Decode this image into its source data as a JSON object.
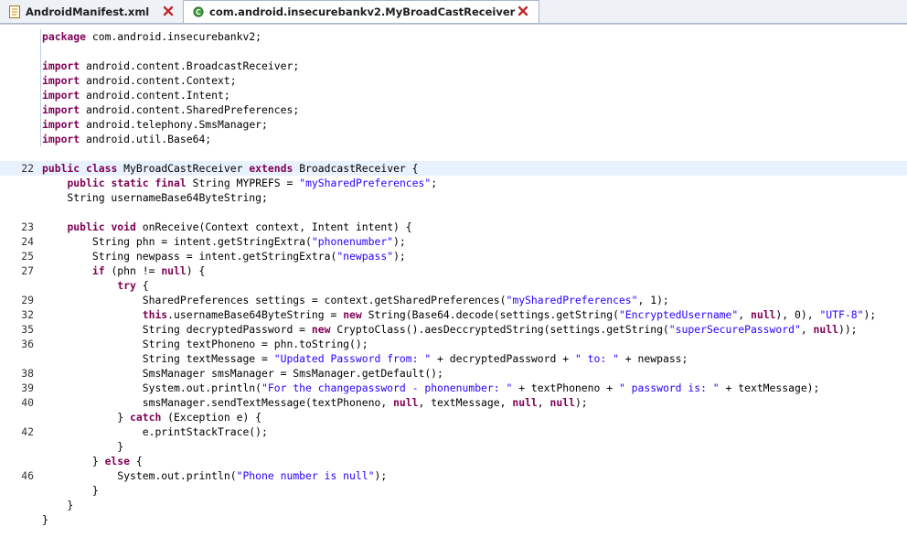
{
  "tabs": [
    {
      "label": "AndroidManifest.xml",
      "icon": "xml-file-icon",
      "active": false
    },
    {
      "label": "com.android.insecurebankv2.MyBroadCastReceiver",
      "icon": "java-class-icon",
      "active": true
    }
  ],
  "colors": {
    "keyword": "#7f0055",
    "string": "#2a00ff",
    "current_line": "#e8f2fe",
    "close": "#c1282d"
  },
  "code": [
    {
      "n": "",
      "parts": [
        {
          "t": "package",
          "c": "kw"
        },
        {
          "t": " com.android.insecurebankv2;"
        }
      ]
    },
    {
      "n": "",
      "parts": []
    },
    {
      "n": "",
      "parts": [
        {
          "t": "import",
          "c": "kw"
        },
        {
          "t": " android.content.BroadcastReceiver;"
        }
      ]
    },
    {
      "n": "",
      "parts": [
        {
          "t": "import",
          "c": "kw"
        },
        {
          "t": " android.content.Context;"
        }
      ]
    },
    {
      "n": "",
      "parts": [
        {
          "t": "import",
          "c": "kw"
        },
        {
          "t": " android.content.Intent;"
        }
      ]
    },
    {
      "n": "",
      "parts": [
        {
          "t": "import",
          "c": "kw"
        },
        {
          "t": " android.content.SharedPreferences;"
        }
      ]
    },
    {
      "n": "",
      "parts": [
        {
          "t": "import",
          "c": "kw"
        },
        {
          "t": " android.telephony.SmsManager;"
        }
      ]
    },
    {
      "n": "",
      "parts": [
        {
          "t": "import",
          "c": "kw"
        },
        {
          "t": " android.util.Base64;"
        }
      ]
    },
    {
      "n": "",
      "parts": []
    },
    {
      "n": "22",
      "current": true,
      "parts": [
        {
          "t": "public",
          "c": "kw"
        },
        {
          "t": " "
        },
        {
          "t": "class",
          "c": "kw"
        },
        {
          "t": " MyBroadCastReceiver "
        },
        {
          "t": "extends",
          "c": "kw"
        },
        {
          "t": " BroadcastReceiver {"
        }
      ]
    },
    {
      "n": "",
      "parts": [
        {
          "t": "    "
        },
        {
          "t": "public",
          "c": "kw"
        },
        {
          "t": " "
        },
        {
          "t": "static",
          "c": "kw"
        },
        {
          "t": " "
        },
        {
          "t": "final",
          "c": "kw"
        },
        {
          "t": " String MYPREFS = "
        },
        {
          "t": "\"mySharedPreferences\"",
          "c": "str"
        },
        {
          "t": ";"
        }
      ]
    },
    {
      "n": "",
      "parts": [
        {
          "t": "    String usernameBase64ByteString;"
        }
      ]
    },
    {
      "n": "",
      "parts": []
    },
    {
      "n": "23",
      "parts": [
        {
          "t": "    "
        },
        {
          "t": "public",
          "c": "kw"
        },
        {
          "t": " "
        },
        {
          "t": "void",
          "c": "kw"
        },
        {
          "t": " onReceive(Context context, Intent intent) {"
        }
      ]
    },
    {
      "n": "24",
      "parts": [
        {
          "t": "        String phn = intent.getStringExtra("
        },
        {
          "t": "\"phonenumber\"",
          "c": "str"
        },
        {
          "t": ");"
        }
      ]
    },
    {
      "n": "25",
      "parts": [
        {
          "t": "        String newpass = intent.getStringExtra("
        },
        {
          "t": "\"newpass\"",
          "c": "str"
        },
        {
          "t": ");"
        }
      ]
    },
    {
      "n": "27",
      "parts": [
        {
          "t": "        "
        },
        {
          "t": "if",
          "c": "kw"
        },
        {
          "t": " (phn != "
        },
        {
          "t": "null",
          "c": "kw"
        },
        {
          "t": ") {"
        }
      ]
    },
    {
      "n": "",
      "parts": [
        {
          "t": "            "
        },
        {
          "t": "try",
          "c": "kw"
        },
        {
          "t": " {"
        }
      ]
    },
    {
      "n": "29",
      "parts": [
        {
          "t": "                SharedPreferences settings = context.getSharedPreferences("
        },
        {
          "t": "\"mySharedPreferences\"",
          "c": "str"
        },
        {
          "t": ", 1);"
        }
      ]
    },
    {
      "n": "32",
      "parts": [
        {
          "t": "                "
        },
        {
          "t": "this",
          "c": "kw"
        },
        {
          "t": ".usernameBase64ByteString = "
        },
        {
          "t": "new",
          "c": "kw"
        },
        {
          "t": " String(Base64.decode(settings.getString("
        },
        {
          "t": "\"EncryptedUsername\"",
          "c": "str"
        },
        {
          "t": ", "
        },
        {
          "t": "null",
          "c": "kw"
        },
        {
          "t": "), 0), "
        },
        {
          "t": "\"UTF-8\"",
          "c": "str"
        },
        {
          "t": ");"
        }
      ]
    },
    {
      "n": "35",
      "parts": [
        {
          "t": "                String decryptedPassword = "
        },
        {
          "t": "new",
          "c": "kw"
        },
        {
          "t": " CryptoClass().aesDeccryptedString(settings.getString("
        },
        {
          "t": "\"superSecurePassword\"",
          "c": "str"
        },
        {
          "t": ", "
        },
        {
          "t": "null",
          "c": "kw"
        },
        {
          "t": "));"
        }
      ]
    },
    {
      "n": "36",
      "parts": [
        {
          "t": "                String textPhoneno = phn.toString();"
        }
      ]
    },
    {
      "n": "",
      "parts": [
        {
          "t": "                String textMessage = "
        },
        {
          "t": "\"Updated Password from: \"",
          "c": "str"
        },
        {
          "t": " + decryptedPassword + "
        },
        {
          "t": "\" to: \"",
          "c": "str"
        },
        {
          "t": " + newpass;"
        }
      ]
    },
    {
      "n": "38",
      "parts": [
        {
          "t": "                SmsManager smsManager = SmsManager.getDefault();"
        }
      ]
    },
    {
      "n": "39",
      "parts": [
        {
          "t": "                System.out.println("
        },
        {
          "t": "\"For the changepassword - phonenumber: \"",
          "c": "str"
        },
        {
          "t": " + textPhoneno + "
        },
        {
          "t": "\" password is: \"",
          "c": "str"
        },
        {
          "t": " + textMessage);"
        }
      ]
    },
    {
      "n": "40",
      "parts": [
        {
          "t": "                smsManager.sendTextMessage(textPhoneno, "
        },
        {
          "t": "null",
          "c": "kw"
        },
        {
          "t": ", textMessage, "
        },
        {
          "t": "null",
          "c": "kw"
        },
        {
          "t": ", "
        },
        {
          "t": "null",
          "c": "kw"
        },
        {
          "t": ");"
        }
      ]
    },
    {
      "n": "",
      "parts": [
        {
          "t": "            } "
        },
        {
          "t": "catch",
          "c": "kw"
        },
        {
          "t": " (Exception e) {"
        }
      ]
    },
    {
      "n": "42",
      "parts": [
        {
          "t": "                e.printStackTrace();"
        }
      ]
    },
    {
      "n": "",
      "parts": [
        {
          "t": "            }"
        }
      ]
    },
    {
      "n": "",
      "parts": [
        {
          "t": "        } "
        },
        {
          "t": "else",
          "c": "kw"
        },
        {
          "t": " {"
        }
      ]
    },
    {
      "n": "46",
      "parts": [
        {
          "t": "            System.out.println("
        },
        {
          "t": "\"Phone number is null\"",
          "c": "str"
        },
        {
          "t": ");"
        }
      ]
    },
    {
      "n": "",
      "parts": [
        {
          "t": "        }"
        }
      ]
    },
    {
      "n": "",
      "parts": [
        {
          "t": "    }"
        }
      ]
    },
    {
      "n": "",
      "parts": [
        {
          "t": "}"
        }
      ]
    }
  ]
}
